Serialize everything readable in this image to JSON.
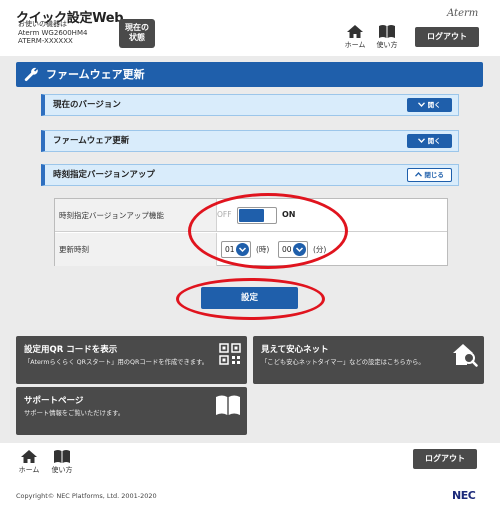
{
  "header": {
    "app_title": "クイック設定Web",
    "device_label": "お使いの機器は",
    "device_model": "Aterm WG2600HM4",
    "device_id": "ATERM-XXXXXX",
    "status_button_line1": "現在の",
    "status_button_line2": "状態",
    "home_label": "ホーム",
    "manual_label": "使い方",
    "brand_logo": "Aterm",
    "logout_label": "ログアウト"
  },
  "page": {
    "title": "ファームウェア更新"
  },
  "sections": [
    {
      "label": "現在のバージョン",
      "button": "開く",
      "expanded": false
    },
    {
      "label": "ファームウェア更新",
      "button": "開く",
      "expanded": false
    },
    {
      "label": "時刻指定バージョンアップ",
      "button": "閉じる",
      "expanded": true
    }
  ],
  "settings": {
    "scheduled_update_label": "時刻指定バージョンアップ機能",
    "toggle_off_label": "OFF",
    "toggle_on_label": "ON",
    "toggle_state": "ON",
    "update_time_label": "更新時刻",
    "hour_value": "01",
    "hour_unit": "(時)",
    "minute_value": "00",
    "minute_unit": "(分)",
    "submit_label": "設定"
  },
  "tiles": [
    {
      "title": "設定用QR コードを表示",
      "desc": "「Atermらくらく QRスタート」用のQRコードを作成できます。",
      "icon": "qr-code-icon"
    },
    {
      "title": "見えて安心ネット",
      "desc": "「こども安心ネットタイマー」などの設定はこちらから。",
      "icon": "home-search-icon"
    },
    {
      "title": "サポートページ",
      "desc": "サポート情報をご覧いただけます。",
      "icon": "book-icon"
    }
  ],
  "footer": {
    "home_label": "ホーム",
    "manual_label": "使い方",
    "logout_label": "ログアウト",
    "copyright": "Copyright© NEC Platforms, Ltd. 2001-2020",
    "company_logo": "NEC"
  },
  "colors": {
    "primary": "#1f5fab",
    "tile_bg": "#4a4a4a",
    "annotation_red": "#e0141e"
  }
}
